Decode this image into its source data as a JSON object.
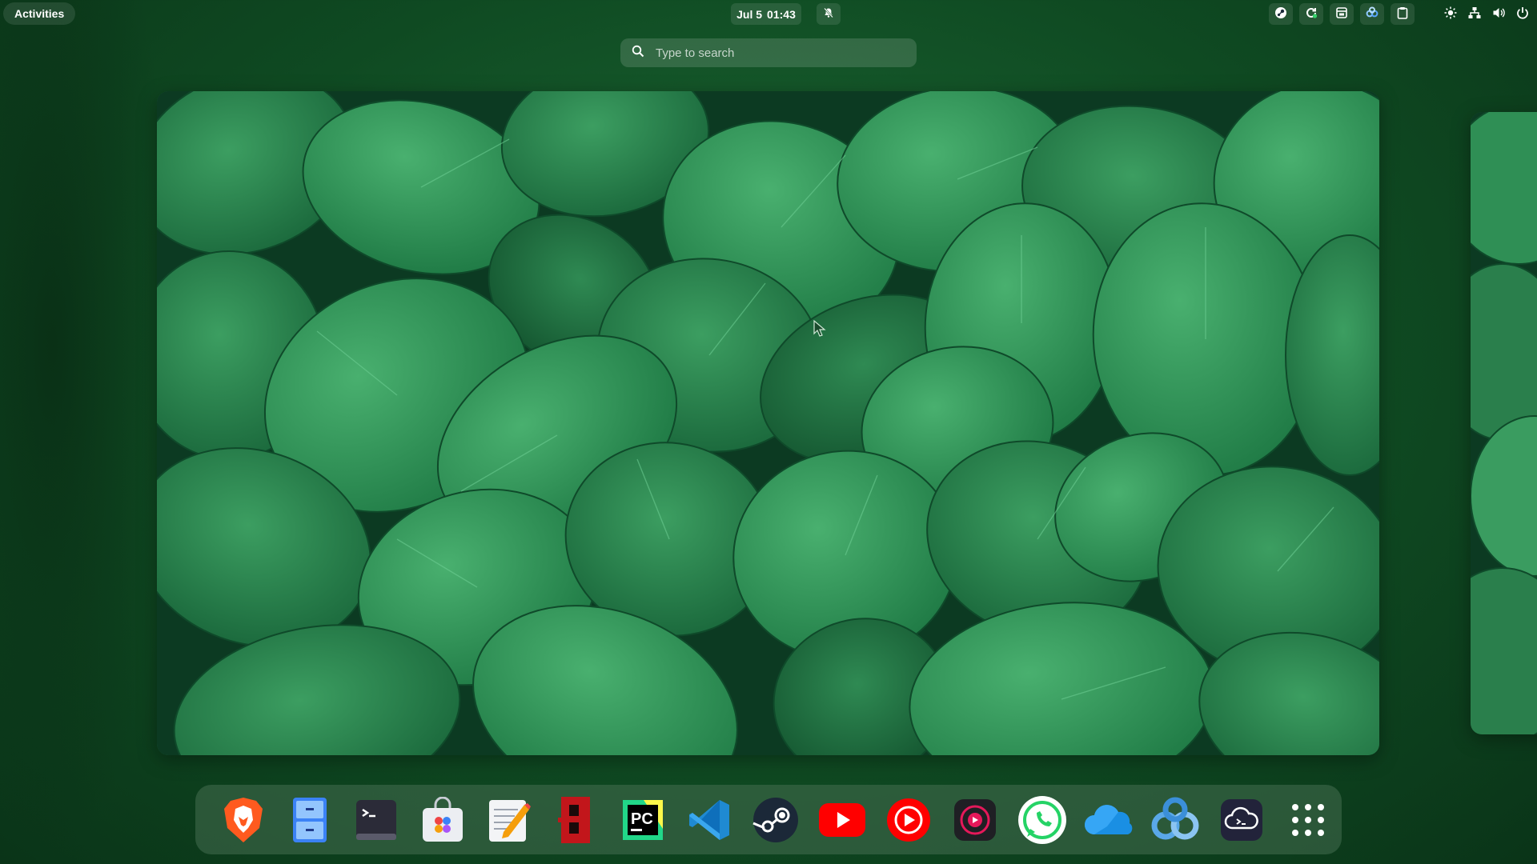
{
  "topbar": {
    "activities_label": "Activities",
    "date": "Jul 5",
    "time": "01:43"
  },
  "search": {
    "placeholder": "Type to search"
  },
  "tray_icons": [
    "steam-tray-icon",
    "update-tray-icon",
    "clipboard-manager-icon",
    "nextcloud-tray-icon",
    "clipboard-icon"
  ],
  "system_icons": [
    "brightness-icon",
    "network-icon",
    "volume-icon",
    "power-icon"
  ],
  "dock": {
    "apps": [
      "Brave Browser",
      "Files",
      "Terminal",
      "Software",
      "Text Editor",
      "Bitwarden",
      "PyCharm",
      "Visual Studio Code",
      "Steam",
      "YouTube",
      "YouTube Music",
      "Podcasts",
      "WhatsApp",
      "OneDrive",
      "Nextcloud",
      "Cloud Terminal",
      "Show Applications"
    ]
  },
  "colors": {
    "wallpaper_green": "#1f6b3e",
    "leaf_light": "#3fa866",
    "leaf_dark": "#0c3a22"
  }
}
